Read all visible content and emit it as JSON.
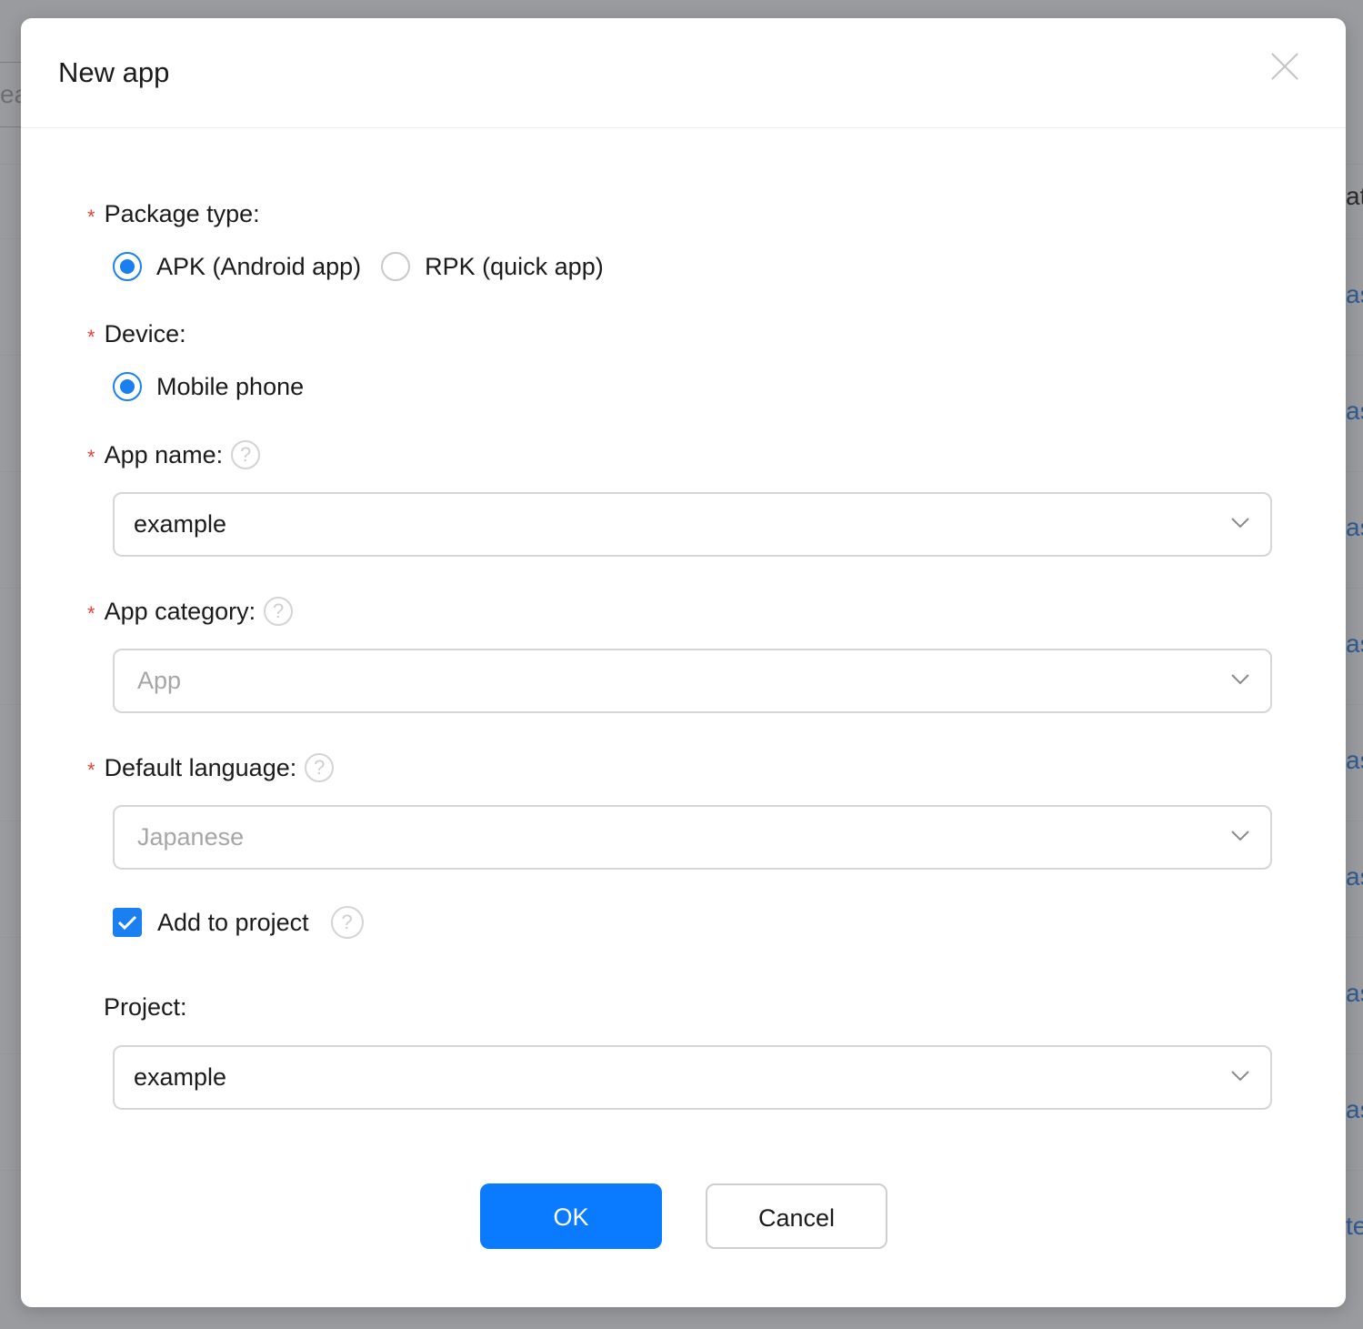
{
  "background": {
    "search_fragment": "ea",
    "column_header_fragment": "at",
    "link_fragment": "as",
    "last_link_fragment": "te"
  },
  "dialog": {
    "title": "New app",
    "close_icon": "close-icon"
  },
  "form": {
    "package_type": {
      "label": "Package type:",
      "required_mark": "*",
      "options": [
        {
          "label": "APK (Android app)",
          "selected": true
        },
        {
          "label": "RPK (quick app)",
          "selected": false
        }
      ]
    },
    "device": {
      "label": "Device:",
      "required_mark": "*",
      "options": [
        {
          "label": "Mobile phone",
          "selected": true
        }
      ]
    },
    "app_name": {
      "label": "App name:",
      "required_mark": "*",
      "help_icon": "question-circle-icon",
      "value": "example"
    },
    "app_category": {
      "label": "App category:",
      "required_mark": "*",
      "help_icon": "question-circle-icon",
      "placeholder": "App"
    },
    "default_language": {
      "label": "Default language:",
      "required_mark": "*",
      "help_icon": "question-circle-icon",
      "placeholder": "Japanese"
    },
    "add_to_project": {
      "label": "Add to project",
      "checked": true,
      "help_icon": "question-circle-icon"
    },
    "project": {
      "label": "Project:",
      "value": "example"
    }
  },
  "buttons": {
    "ok_label": "OK",
    "cancel_label": "Cancel"
  },
  "colors": {
    "accent": "#0a7bff",
    "required": "#e8413c",
    "placeholder": "#a6a6a6"
  }
}
